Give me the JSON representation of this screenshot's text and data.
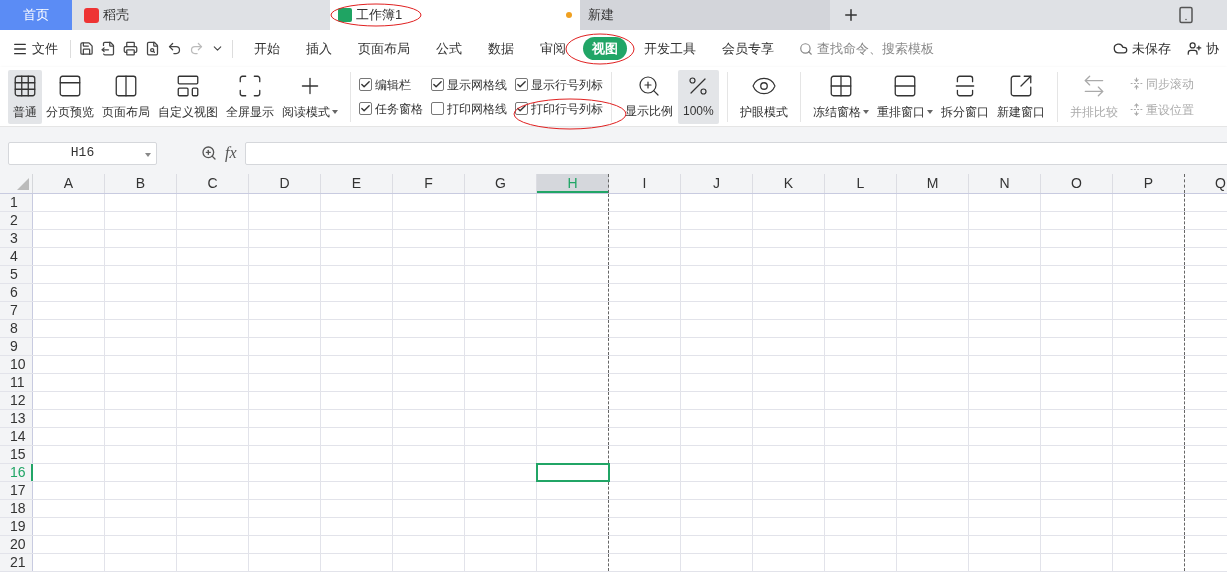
{
  "tabs": [
    {
      "kind": "home",
      "label": "首页",
      "selected": false
    },
    {
      "kind": "docer",
      "label": "稻壳",
      "selected": false
    },
    {
      "kind": "sheet",
      "label": "工作簿1",
      "selected": true,
      "unsaved": true
    },
    {
      "kind": "plain",
      "label": "新建",
      "selected": false
    }
  ],
  "menu": {
    "file": "文件",
    "tabs": [
      {
        "label": "开始",
        "selected": false
      },
      {
        "label": "插入",
        "selected": false
      },
      {
        "label": "页面布局",
        "selected": false
      },
      {
        "label": "公式",
        "selected": false
      },
      {
        "label": "数据",
        "selected": false
      },
      {
        "label": "审阅",
        "selected": false
      },
      {
        "label": "视图",
        "selected": true
      },
      {
        "label": "开发工具",
        "selected": false
      },
      {
        "label": "会员专享",
        "selected": false
      }
    ],
    "search_placeholder": "查找命令、搜索模板",
    "save_status": "未保存",
    "collab": "协"
  },
  "ribbon": {
    "views": [
      {
        "label": "普通",
        "selected": true,
        "dropdown": false
      },
      {
        "label": "分页预览",
        "selected": false,
        "dropdown": false
      },
      {
        "label": "页面布局",
        "selected": false,
        "dropdown": false
      },
      {
        "label": "自定义视图",
        "selected": false,
        "dropdown": false
      },
      {
        "label": "全屏显示",
        "selected": false,
        "dropdown": false
      },
      {
        "label": "阅读模式",
        "selected": false,
        "dropdown": true
      }
    ],
    "checkboxes": [
      {
        "label": "编辑栏",
        "checked": true
      },
      {
        "label": "任务窗格",
        "checked": true
      },
      {
        "label": "显示网格线",
        "checked": true
      },
      {
        "label": "打印网格线",
        "checked": false
      },
      {
        "label": "显示行号列标",
        "checked": true
      },
      {
        "label": "打印行号列标",
        "checked": true
      }
    ],
    "zoom": [
      {
        "label": "显示比例",
        "selected": false
      },
      {
        "label": "100%",
        "selected": true
      }
    ],
    "tools": [
      {
        "label": "护眼模式",
        "dropdown": false,
        "disabled": false
      },
      {
        "label": "冻结窗格",
        "dropdown": true,
        "disabled": false
      },
      {
        "label": "重排窗口",
        "dropdown": true,
        "disabled": false
      },
      {
        "label": "拆分窗口",
        "dropdown": false,
        "disabled": false
      },
      {
        "label": "新建窗口",
        "dropdown": false,
        "disabled": false
      },
      {
        "label": "并排比较",
        "dropdown": false,
        "disabled": true
      }
    ],
    "small": [
      {
        "label": "同步滚动",
        "disabled": true
      },
      {
        "label": "重设位置",
        "disabled": true
      }
    ]
  },
  "formula_bar": {
    "name_box": "H16",
    "fx": "fx"
  },
  "sheet": {
    "columns": [
      {
        "label": "A",
        "selected": false,
        "page_break_after": false
      },
      {
        "label": "B",
        "selected": false,
        "page_break_after": false
      },
      {
        "label": "C",
        "selected": false,
        "page_break_after": false
      },
      {
        "label": "D",
        "selected": false,
        "page_break_after": false
      },
      {
        "label": "E",
        "selected": false,
        "page_break_after": false
      },
      {
        "label": "F",
        "selected": false,
        "page_break_after": false
      },
      {
        "label": "G",
        "selected": false,
        "page_break_after": false
      },
      {
        "label": "H",
        "selected": true,
        "page_break_after": true
      },
      {
        "label": "I",
        "selected": false,
        "page_break_after": false
      },
      {
        "label": "J",
        "selected": false,
        "page_break_after": false
      },
      {
        "label": "K",
        "selected": false,
        "page_break_after": false
      },
      {
        "label": "L",
        "selected": false,
        "page_break_after": false
      },
      {
        "label": "M",
        "selected": false,
        "page_break_after": false
      },
      {
        "label": "N",
        "selected": false,
        "page_break_after": false
      },
      {
        "label": "O",
        "selected": false,
        "page_break_after": false
      },
      {
        "label": "P",
        "selected": false,
        "page_break_after": true
      },
      {
        "label": "Q",
        "selected": false
      }
    ],
    "rows": [
      {
        "label": "1",
        "selected": false
      },
      {
        "label": "2",
        "selected": false
      },
      {
        "label": "3",
        "selected": false
      },
      {
        "label": "4",
        "selected": false
      },
      {
        "label": "5",
        "selected": false
      },
      {
        "label": "6",
        "selected": false
      },
      {
        "label": "7",
        "selected": false
      },
      {
        "label": "8",
        "selected": false
      },
      {
        "label": "9",
        "selected": false
      },
      {
        "label": "10",
        "selected": false
      },
      {
        "label": "11",
        "selected": false
      },
      {
        "label": "12",
        "selected": false
      },
      {
        "label": "13",
        "selected": false
      },
      {
        "label": "14",
        "selected": false
      },
      {
        "label": "15",
        "selected": false
      },
      {
        "label": "16",
        "selected": true
      },
      {
        "label": "17",
        "selected": false
      },
      {
        "label": "18",
        "selected": false
      },
      {
        "label": "19",
        "selected": false
      },
      {
        "label": "20",
        "selected": false
      },
      {
        "label": "21",
        "selected": false
      }
    ]
  }
}
